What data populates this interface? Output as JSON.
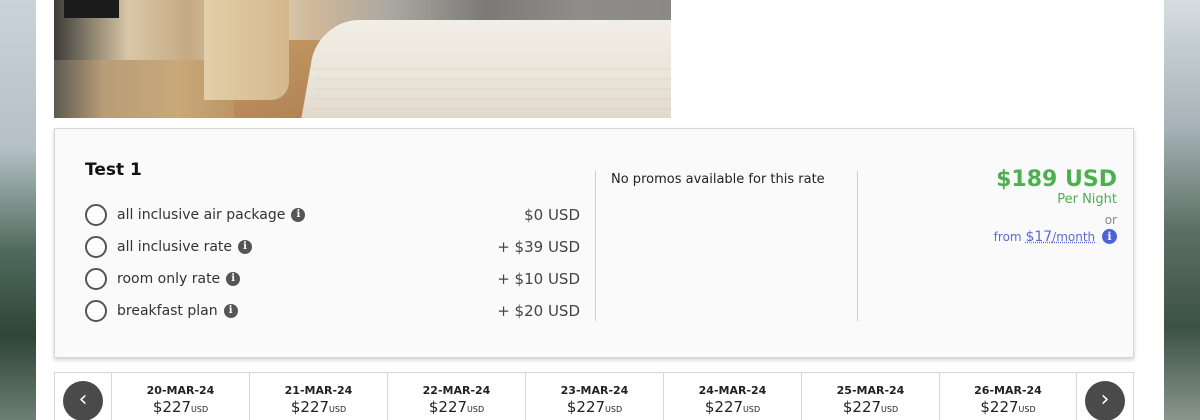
{
  "rate": {
    "title": "Test 1",
    "options": [
      {
        "label": "all inclusive air package",
        "price": "$0 USD"
      },
      {
        "label": "all inclusive rate",
        "price": "+ $39 USD"
      },
      {
        "label": "room only rate",
        "price": "+ $10 USD"
      },
      {
        "label": "breakfast plan",
        "price": "+ $20 USD"
      }
    ],
    "info_glyph": "i",
    "promo_text": "No promos available for this rate",
    "price": "$189 USD",
    "per_night": "Per Night",
    "or_text": "or",
    "from_prefix": "from",
    "monthly_amount": "$17",
    "monthly_unit": "/month",
    "price_color": "#4caf50",
    "financing_color": "#5a6bd6"
  },
  "date_strip": {
    "prev_glyph": "‹",
    "next_glyph": "›",
    "dates": [
      {
        "date": "20-MAR-24",
        "price": "$227",
        "currency": "USD"
      },
      {
        "date": "21-MAR-24",
        "price": "$227",
        "currency": "USD"
      },
      {
        "date": "22-MAR-24",
        "price": "$227",
        "currency": "USD"
      },
      {
        "date": "23-MAR-24",
        "price": "$227",
        "currency": "USD"
      },
      {
        "date": "24-MAR-24",
        "price": "$227",
        "currency": "USD"
      },
      {
        "date": "25-MAR-24",
        "price": "$227",
        "currency": "USD"
      },
      {
        "date": "26-MAR-24",
        "price": "$227",
        "currency": "USD"
      }
    ]
  }
}
